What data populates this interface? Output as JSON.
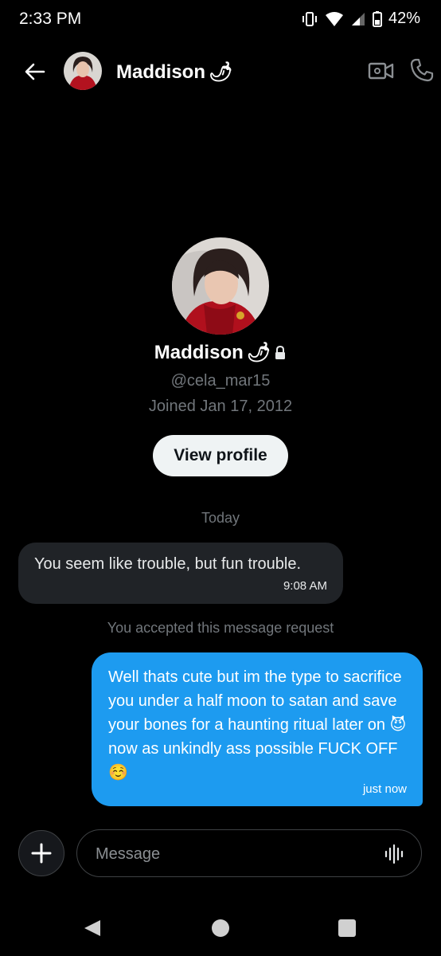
{
  "status_bar": {
    "time": "2:33 PM",
    "battery": "42%"
  },
  "header": {
    "name": "Maddison",
    "name_emoji": "🌶"
  },
  "profile": {
    "name": "Maddison",
    "name_emoji": "🌶",
    "handle": "@cela_mar15",
    "joined": "Joined Jan 17, 2012",
    "view_profile_label": "View profile"
  },
  "conversation": {
    "day_label": "Today",
    "incoming": {
      "text": "You seem like trouble, but fun trouble.",
      "time": "9:08 AM"
    },
    "system_notice": "You accepted this message request",
    "outgoing": {
      "text": "Well thats cute but im the type to sacrifice you under a half moon to satan and save your bones for a haunting ritual later on 😈 now as unkindly ass possible FUCK OFF ☺️",
      "time": "just now"
    }
  },
  "composer": {
    "placeholder": "Message"
  },
  "colors": {
    "accent": "#1d9bf0",
    "bubble_in": "#202327",
    "background": "#000000"
  },
  "icons": [
    "back-arrow-icon",
    "video-call-icon",
    "phone-icon",
    "lock-icon",
    "plus-icon",
    "voice-message-icon",
    "vibrate-icon",
    "wifi-icon",
    "signal-icon",
    "battery-icon"
  ]
}
